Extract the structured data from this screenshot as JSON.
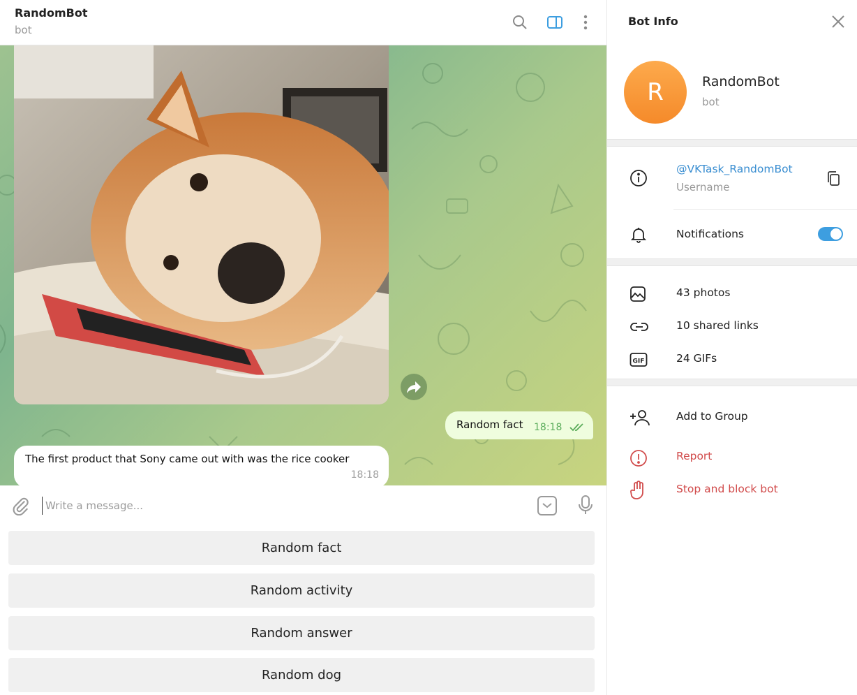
{
  "chat": {
    "title": "RandomBot",
    "subtitle": "bot",
    "outgoing": {
      "text": "Random fact",
      "time": "18:18"
    },
    "incoming": {
      "text": "The first product that Sony came out with was the rice cooker",
      "time": "18:18"
    },
    "composer": {
      "placeholder": "Write a message..."
    },
    "keyboard": [
      "Random fact",
      "Random activity",
      "Random answer",
      "Random dog"
    ]
  },
  "info": {
    "title": "Bot Info",
    "avatar_letter": "R",
    "name": "RandomBot",
    "subtitle": "bot",
    "username": "@VKTask_RandomBot",
    "username_label": "Username",
    "notifications_label": "Notifications",
    "notifications_on": true,
    "media": {
      "photos": "43 photos",
      "links": "10 shared links",
      "gifs": "24 GIFs"
    },
    "actions": {
      "add_to_group": "Add to Group",
      "report": "Report",
      "stop_block": "Stop and block bot"
    }
  },
  "colors": {
    "accent": "#3d9ee0",
    "danger": "#d14b4b",
    "out_bubble": "#effdde",
    "avatar": "#f58a2a"
  }
}
